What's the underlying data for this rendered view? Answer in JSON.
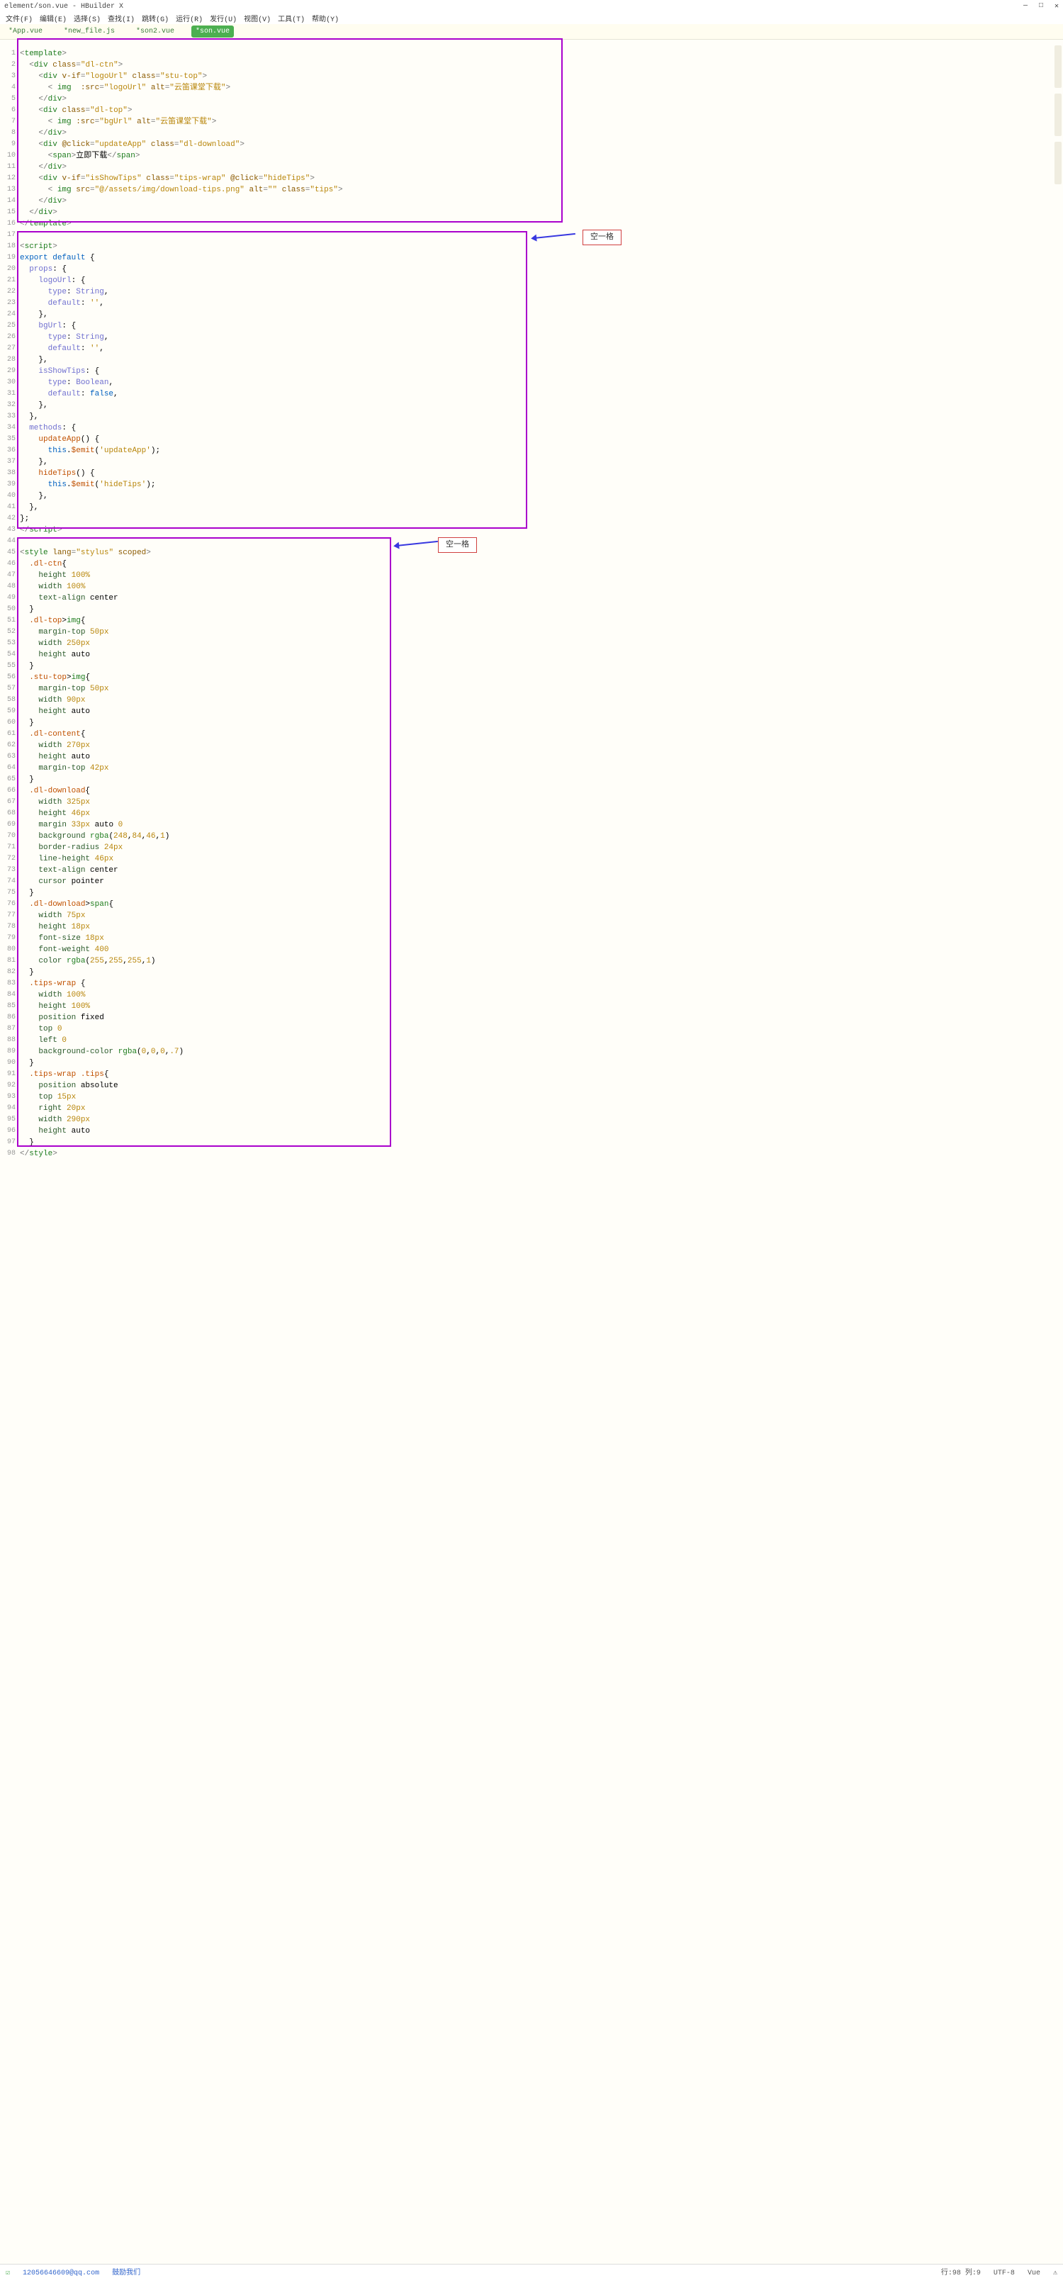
{
  "title": "element/son.vue - HBuilder X",
  "win": {
    "min": "—",
    "max": "□",
    "close": "✕"
  },
  "menu": [
    "文件(F)",
    "编辑(E)",
    "选择(S)",
    "查找(I)",
    "跳转(G)",
    "运行(R)",
    "发行(U)",
    "视图(V)",
    "工具(T)",
    "帮助(Y)"
  ],
  "tabs": [
    {
      "label": "*App.vue",
      "active": false
    },
    {
      "label": "*new_file.js",
      "active": false
    },
    {
      "label": "*son2.vue",
      "active": false
    },
    {
      "label": "*son.vue",
      "active": true
    }
  ],
  "badges": {
    "b1": "空一格",
    "b2": "空一格"
  },
  "status": {
    "left": {
      "icon": "☑",
      "email": "12056646609@qq.com",
      "feedback": "鼓励我们"
    },
    "right": {
      "pos": "行:98 列:9",
      "enc": "UTF-8",
      "lang": "Vue",
      "warn": "⚠"
    }
  },
  "lines": [
    "1",
    "2",
    "3",
    "4",
    "5",
    "6",
    "7",
    "8",
    "9",
    "10",
    "11",
    "12",
    "13",
    "14",
    "15",
    "16",
    "17",
    "18",
    "19",
    "20",
    "21",
    "22",
    "23",
    "24",
    "25",
    "26",
    "27",
    "28",
    "29",
    "30",
    "31",
    "32",
    "33",
    "34",
    "35",
    "36",
    "37",
    "38",
    "39",
    "40",
    "41",
    "42",
    "43",
    "44",
    "45",
    "46",
    "47",
    "48",
    "49",
    "50",
    "51",
    "52",
    "53",
    "54",
    "55",
    "56",
    "57",
    "58",
    "59",
    "60",
    "61",
    "62",
    "63",
    "64",
    "65",
    "66",
    "67",
    "68",
    "69",
    "70",
    "71",
    "72",
    "73",
    "74",
    "75",
    "76",
    "77",
    "78",
    "79",
    "80",
    "81",
    "82",
    "83",
    "84",
    "85",
    "86",
    "87",
    "88",
    "89",
    "90",
    "91",
    "92",
    "93",
    "94",
    "95",
    "96",
    "97",
    "98"
  ],
  "code": {
    "template": {
      "l1": {
        "open": "<",
        "tag": "template",
        "close": ">"
      },
      "l2": {
        "i": "  ",
        "open": "<",
        "tag": "div",
        "sp": " ",
        "attr": "class",
        "eq": "=",
        "val": "\"dl-ctn\"",
        "close": ">"
      },
      "l3": {
        "i": "    ",
        "open": "<",
        "tag": "div",
        "sp": " ",
        "a1": "v-if",
        "e1": "=",
        "v1": "\"logoUrl\"",
        "sp2": " ",
        "a2": "class",
        "e2": "=",
        "v2": "\"stu-top\"",
        "close": ">"
      },
      "l4": {
        "i": "      ",
        "open": "< ",
        "tag": "img",
        "sp": "  ",
        "a1": ":src",
        "e1": "=",
        "v1": "\"logoUrl\"",
        "sp2": " ",
        "a2": "alt",
        "e2": "=",
        "v2": "\"云笛课堂下载\"",
        "close": ">"
      },
      "l5": {
        "i": "    ",
        "open": "</",
        "tag": "div",
        "close": ">"
      },
      "l6": {
        "i": "    ",
        "open": "<",
        "tag": "div",
        "sp": " ",
        "attr": "class",
        "eq": "=",
        "val": "\"dl-top\"",
        "close": ">"
      },
      "l7": {
        "i": "      ",
        "open": "< ",
        "tag": "img",
        "sp": " ",
        "a1": ":src",
        "e1": "=",
        "v1": "\"bgUrl\"",
        "sp2": " ",
        "a2": "alt",
        "e2": "=",
        "v2": "\"云笛课堂下载\"",
        "close": ">"
      },
      "l8": {
        "i": "    ",
        "open": "</",
        "tag": "div",
        "close": ">"
      },
      "l9": {
        "i": "    ",
        "open": "<",
        "tag": "div",
        "sp": " ",
        "a1": "@click",
        "e1": "=",
        "v1": "\"updateApp\"",
        "sp2": " ",
        "a2": "class",
        "e2": "=",
        "v2": "\"dl-download\"",
        "close": ">"
      },
      "l10": {
        "i": "      ",
        "open": "<",
        "tag": "span",
        "close": ">",
        "text": "立即下载",
        "open2": "</",
        "tag2": "span",
        "close2": ">"
      },
      "l11": {
        "i": "    ",
        "open": "</",
        "tag": "div",
        "close": ">"
      },
      "l12": {
        "i": "    ",
        "open": "<",
        "tag": "div",
        "sp": " ",
        "a1": "v-if",
        "e1": "=",
        "v1": "\"isShowTips\"",
        "sp2": " ",
        "a2": "class",
        "e2": "=",
        "v2": "\"tips-wrap\"",
        "sp3": " ",
        "a3": "@click",
        "e3": "=",
        "v3": "\"hideTips\"",
        "close": ">"
      },
      "l13": {
        "i": "      ",
        "open": "< ",
        "tag": "img",
        "sp": " ",
        "a1": "src",
        "e1": "=",
        "v1": "\"@/assets/img/download-tips.png\"",
        "sp2": " ",
        "a2": "alt",
        "e2": "=",
        "v2": "\"\"",
        "sp3": " ",
        "a3": "class",
        "e3": "=",
        "v3": "\"tips\"",
        "close": ">"
      },
      "l14": {
        "i": "    ",
        "open": "</",
        "tag": "div",
        "close": ">"
      },
      "l15": {
        "i": "  ",
        "open": "</",
        "tag": "div",
        "close": ">"
      },
      "l16": {
        "open": "</",
        "tag": "template",
        "close": ">"
      }
    },
    "script": {
      "l18": {
        "open": "<",
        "tag": "script",
        "close": ">"
      },
      "l19": {
        "kw1": "export",
        "sp": " ",
        "kw2": "default",
        "txt": " {"
      },
      "l20": {
        "i": "  ",
        "key": "props",
        "txt": ": {"
      },
      "l21": {
        "i": "    ",
        "key": "logoUrl",
        "txt": ": {"
      },
      "l22": {
        "i": "      ",
        "key": "type",
        "txt": ": ",
        "id": "String",
        "c": ","
      },
      "l23": {
        "i": "      ",
        "key": "default",
        "txt": ": ",
        "str": "''",
        "c": ","
      },
      "l24": {
        "i": "    },"
      },
      "l25": {
        "i": "    ",
        "key": "bgUrl",
        "txt": ": {"
      },
      "l26": {
        "i": "      ",
        "key": "type",
        "txt": ": ",
        "id": "String",
        "c": ","
      },
      "l27": {
        "i": "      ",
        "key": "default",
        "txt": ": ",
        "str": "''",
        "c": ","
      },
      "l28": {
        "i": "    },"
      },
      "l29": {
        "i": "    ",
        "key": "isShowTips",
        "txt": ": {"
      },
      "l30": {
        "i": "      ",
        "key": "type",
        "txt": ": ",
        "id": "Boolean",
        "c": ","
      },
      "l31": {
        "i": "      ",
        "key": "default",
        "txt": ": ",
        "id2": "false",
        "c": ","
      },
      "l32": {
        "i": "    },"
      },
      "l33": {
        "i": "  },"
      },
      "l34": {
        "i": "  ",
        "key": "methods",
        "txt": ": {"
      },
      "l35": {
        "i": "    ",
        "fn": "updateApp",
        "txt": "() {"
      },
      "l36": {
        "i": "      ",
        "this": "this",
        "dot": ".",
        "fn": "$emit",
        "p": "(",
        "str": "'updateApp'",
        "p2": ");"
      },
      "l37": {
        "i": "    },"
      },
      "l38": {
        "i": "    ",
        "fn": "hideTips",
        "txt": "() {"
      },
      "l39": {
        "i": "      ",
        "this": "this",
        "dot": ".",
        "fn": "$emit",
        "p": "(",
        "str": "'hideTips'",
        "p2": ");"
      },
      "l40": {
        "i": "    },"
      },
      "l41": {
        "i": "  },"
      },
      "l42": {
        "txt": "};"
      },
      "l43": {
        "open": "</",
        "tag": "script",
        "close": ">"
      }
    },
    "style": {
      "l45": {
        "open": "<",
        "tag": "style",
        "sp": " ",
        "a1": "lang",
        "e1": "=",
        "v1": "\"stylus\"",
        "sp2": " ",
        "a2": "scoped",
        "close": ">"
      },
      "l46": {
        "i": "  ",
        "sel": ".dl-ctn",
        "txt": "{"
      },
      "l47": {
        "i": "    ",
        "prop": "height",
        "sp": " ",
        "num": "100%"
      },
      "l48": {
        "i": "    ",
        "prop": "width",
        "sp": " ",
        "num": "100%"
      },
      "l49": {
        "i": "    ",
        "prop": "text-align",
        "sp": " ",
        "val": "center"
      },
      "l50": {
        "i": "  }"
      },
      "l51": {
        "i": "  ",
        "sel": ".dl-top",
        "gt": ">",
        "sel2": "img",
        "txt": "{"
      },
      "l52": {
        "i": "    ",
        "prop": "margin-top",
        "sp": " ",
        "num": "50px"
      },
      "l53": {
        "i": "    ",
        "prop": "width",
        "sp": " ",
        "num": "250px"
      },
      "l54": {
        "i": "    ",
        "prop": "height",
        "sp": " ",
        "val": "auto"
      },
      "l55": {
        "i": "  }"
      },
      "l56": {
        "i": "  ",
        "sel": ".stu-top",
        "gt": ">",
        "sel2": "img",
        "txt": "{"
      },
      "l57": {
        "i": "    ",
        "prop": "margin-top",
        "sp": " ",
        "num": "50px"
      },
      "l58": {
        "i": "    ",
        "prop": "width",
        "sp": " ",
        "num": "90px"
      },
      "l59": {
        "i": "    ",
        "prop": "height",
        "sp": " ",
        "val": "auto"
      },
      "l60": {
        "i": "  }"
      },
      "l61": {
        "i": "  ",
        "sel": ".dl-content",
        "txt": "{"
      },
      "l62": {
        "i": "    ",
        "prop": "width",
        "sp": " ",
        "num": "270px"
      },
      "l63": {
        "i": "    ",
        "prop": "height",
        "sp": " ",
        "val": "auto"
      },
      "l64": {
        "i": "    ",
        "prop": "margin-top",
        "sp": " ",
        "num": "42px"
      },
      "l65": {
        "i": "  }"
      },
      "l66": {
        "i": "  ",
        "sel": ".dl-download",
        "txt": "{"
      },
      "l67": {
        "i": "    ",
        "prop": "width",
        "sp": " ",
        "num": "325px"
      },
      "l68": {
        "i": "    ",
        "prop": "height",
        "sp": " ",
        "num": "46px"
      },
      "l69": {
        "i": "    ",
        "prop": "margin",
        "sp": " ",
        "num": "33px",
        "sp2": " ",
        "val": "auto",
        "sp3": " ",
        "num2": "0"
      },
      "l70": {
        "i": "    ",
        "prop": "background",
        "sp": " ",
        "fn": "rgba",
        "p": "(",
        "num": "248",
        "c1": ",",
        "num2": "84",
        "c2": ",",
        "num3": "46",
        "c3": ",",
        "num4": "1",
        "p2": ")"
      },
      "l71": {
        "i": "    ",
        "prop": "border-radius",
        "sp": " ",
        "num": "24px"
      },
      "l72": {
        "i": "    ",
        "prop": "line-height",
        "sp": " ",
        "num": "46px"
      },
      "l73": {
        "i": "    ",
        "prop": "text-align",
        "sp": " ",
        "val": "center"
      },
      "l74": {
        "i": "    ",
        "prop": "cursor",
        "sp": " ",
        "val": "pointer"
      },
      "l75": {
        "i": "  }"
      },
      "l76": {
        "i": "  ",
        "sel": ".dl-download",
        "gt": ">",
        "sel2": "span",
        "txt": "{"
      },
      "l77": {
        "i": "    ",
        "prop": "width",
        "sp": " ",
        "num": "75px"
      },
      "l78": {
        "i": "    ",
        "prop": "height",
        "sp": " ",
        "num": "18px"
      },
      "l79": {
        "i": "    ",
        "prop": "font-size",
        "sp": " ",
        "num": "18px"
      },
      "l80": {
        "i": "    ",
        "prop": "font-weight",
        "sp": " ",
        "num": "400"
      },
      "l81": {
        "i": "    ",
        "prop": "color",
        "sp": " ",
        "fn": "rgba",
        "p": "(",
        "num": "255",
        "c1": ",",
        "num2": "255",
        "c2": ",",
        "num3": "255",
        "c3": ",",
        "num4": "1",
        "p2": ")"
      },
      "l82": {
        "i": "  }"
      },
      "l83": {
        "i": "  ",
        "sel": ".tips-wrap",
        "sp": " ",
        "txt": "{"
      },
      "l84": {
        "i": "    ",
        "prop": "width",
        "sp": " ",
        "num": "100%"
      },
      "l85": {
        "i": "    ",
        "prop": "height",
        "sp": " ",
        "num": "100%"
      },
      "l86": {
        "i": "    ",
        "prop": "position",
        "sp": " ",
        "val": "fixed"
      },
      "l87": {
        "i": "    ",
        "prop": "top",
        "sp": " ",
        "num": "0"
      },
      "l88": {
        "i": "    ",
        "prop": "left",
        "sp": " ",
        "num": "0"
      },
      "l89": {
        "i": "    ",
        "prop": "background-color",
        "sp": " ",
        "fn": "rgba",
        "p": "(",
        "num": "0",
        "c1": ",",
        "num2": "0",
        "c2": ",",
        "num3": "0",
        "c3": ",",
        "num4": ".7",
        "p2": ")"
      },
      "l90": {
        "i": "  }"
      },
      "l91": {
        "i": "  ",
        "sel": ".tips-wrap",
        "sp": " ",
        "sel2": ".tips",
        "txt": "{"
      },
      "l92": {
        "i": "    ",
        "prop": "position",
        "sp": " ",
        "val": "absolute"
      },
      "l93": {
        "i": "    ",
        "prop": "top",
        "sp": " ",
        "num": "15px"
      },
      "l94": {
        "i": "    ",
        "prop": "right",
        "sp": " ",
        "num": "20px"
      },
      "l95": {
        "i": "    ",
        "prop": "width",
        "sp": " ",
        "num": "290px"
      },
      "l96": {
        "i": "    ",
        "prop": "height",
        "sp": " ",
        "val": "auto"
      },
      "l97": {
        "i": "  }"
      },
      "l98": {
        "open": "</",
        "tag": "style",
        "close": ">"
      }
    }
  }
}
